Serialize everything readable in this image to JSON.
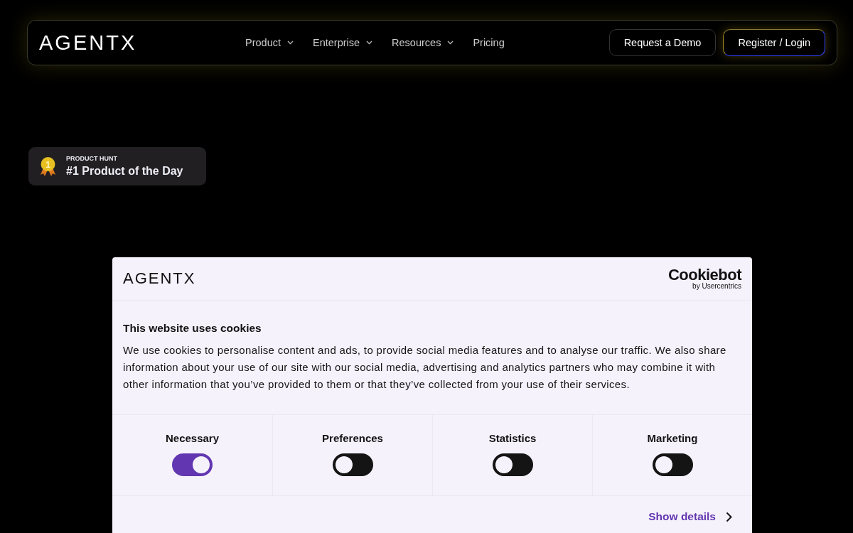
{
  "nav": {
    "logo": "AGENTX",
    "menu": [
      {
        "label": "Product",
        "dropdown": true
      },
      {
        "label": "Enterprise",
        "dropdown": true
      },
      {
        "label": "Resources",
        "dropdown": true
      },
      {
        "label": "Pricing",
        "dropdown": false
      }
    ],
    "buttons": [
      {
        "label": "Request a Demo",
        "kind": "outline"
      },
      {
        "label": "Register / Login",
        "kind": "gradient"
      }
    ]
  },
  "badge": {
    "overline": "PRODUCT HUNT",
    "medal": "1",
    "title": "#1 Product of the Day"
  },
  "cookie_dialog": {
    "logo": "AGENTX",
    "provider": "Cookiebot",
    "provider_sub": "by Usercentrics",
    "title": "This website uses cookies",
    "text": "We use cookies to personalise content and ads, to provide social media features and to analyse our traffic. We also share information about your use of our site with our social media, advertising and analytics partners who may combine it with other information that you’ve provided to them or that they’ve collected from your use of their services.",
    "categories": [
      {
        "label": "Necessary",
        "on": true
      },
      {
        "label": "Preferences",
        "on": false
      },
      {
        "label": "Statistics",
        "on": false
      },
      {
        "label": "Marketing",
        "on": false
      }
    ],
    "details_link": "Show details"
  }
}
